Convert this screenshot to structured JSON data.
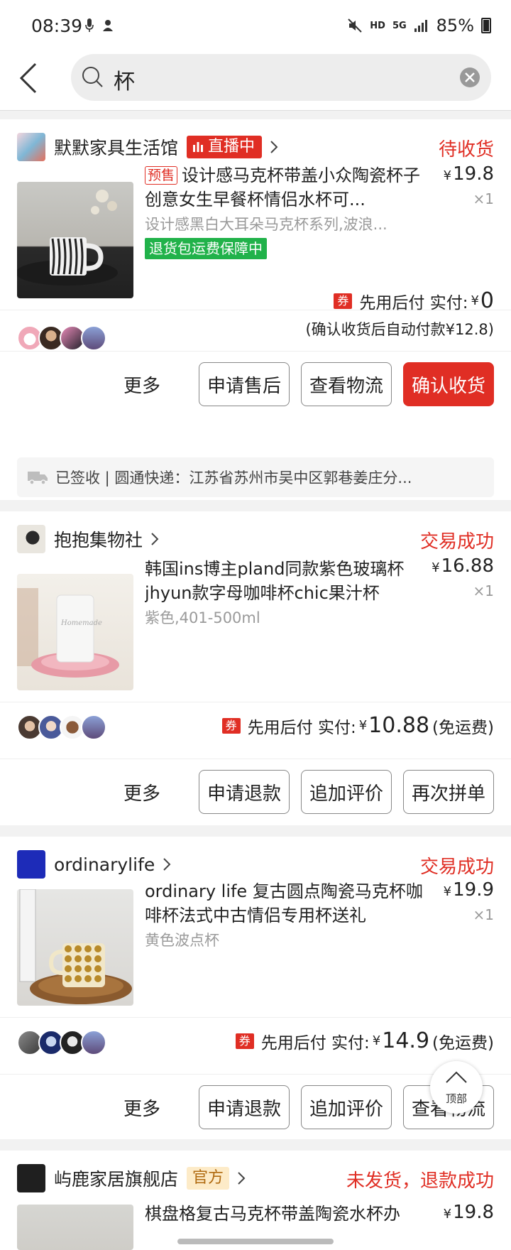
{
  "status_bar": {
    "time": "08:39",
    "network": "5G",
    "hd": "HD",
    "battery": "85%"
  },
  "search": {
    "query": "杯"
  },
  "orders": [
    {
      "shop_name": "默默家具生活馆",
      "live_badge": "直播中",
      "status": "待收货",
      "presale_tag": "预售",
      "title": "设计感马克杯带盖小众陶瓷杯子创意女生早餐杯情侣水杯可...",
      "spec": "设计感黑白大耳朵马克杯系列,波浪...",
      "guarantee": "退货包运费保障中",
      "price": "19.8",
      "quantity": "×1",
      "coupon": "券",
      "pay_label": "先用后付 实付:",
      "pay_amount": "0",
      "pay_note": "(确认收货后自动付款¥12.8)",
      "actions": [
        "更多",
        "申请售后",
        "查看物流",
        "确认收货"
      ],
      "logistics": "已签收 | 圆通快递：江苏省苏州市吴中区郭巷姜庄分..."
    },
    {
      "shop_name": "抱抱集物社",
      "status": "交易成功",
      "title": "韩国ins博主pland同款紫色玻璃杯jhyun款字母咖啡杯chic果汁杯",
      "spec": "紫色,401-500ml",
      "price": "16.88",
      "quantity": "×1",
      "coupon": "券",
      "pay_label": "先用后付 实付:",
      "pay_amount": "10.88",
      "free_ship": "(免运费)",
      "actions": [
        "更多",
        "申请退款",
        "追加评价",
        "再次拼单"
      ]
    },
    {
      "shop_name": "ordinarylife",
      "status": "交易成功",
      "title": "ordinary life 复古圆点陶瓷马克杯咖啡杯法式中古情侣专用杯送礼",
      "spec": "黄色波点杯",
      "price": "19.9",
      "quantity": "×1",
      "coupon": "券",
      "pay_label": "先用后付 实付:",
      "pay_amount": "14.9",
      "free_ship": "(免运费)",
      "actions": [
        "更多",
        "申请退款",
        "追加评价",
        "查看物流"
      ]
    },
    {
      "shop_name": "屿鹿家居旗舰店",
      "official_badge": "官方",
      "status": "未发货，退款成功",
      "title": "棋盘格复古马克杯带盖陶瓷水杯办",
      "price": "19.8"
    }
  ],
  "back_to_top": "顶部",
  "colors": {
    "accent": "#e02e24",
    "guarantee_green": "#21b24a",
    "page_bg": "#f2f2f2"
  },
  "icons": [
    "back-chevron-icon",
    "search-icon",
    "clear-icon",
    "live-bars-icon",
    "chevron-right-icon",
    "truck-icon",
    "arrow-up-icon"
  ]
}
